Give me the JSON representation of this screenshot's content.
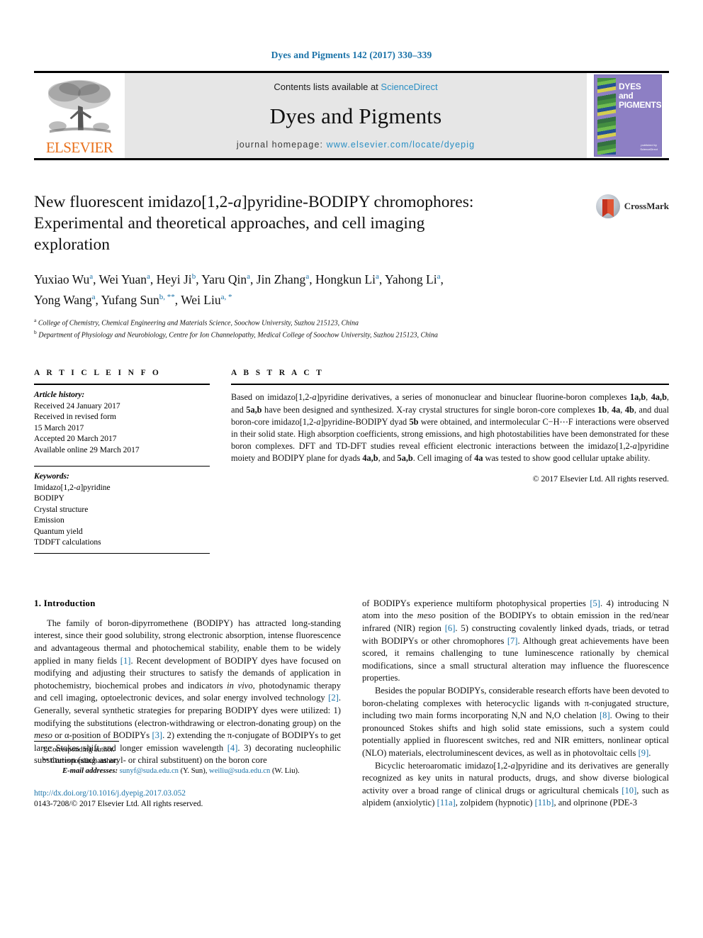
{
  "running_head": "Dyes and Pigments 142 (2017) 330–339",
  "masthead": {
    "publisher_logo_text": "ELSEVIER",
    "contents_prefix": "Contents lists available at ",
    "contents_link": "ScienceDirect",
    "journal_title": "Dyes and Pigments",
    "homepage_prefix": "journal homepage: ",
    "homepage_url": "www.elsevier.com/locate/dyepig",
    "cover": {
      "line1": "DYES",
      "line2": "and",
      "line3": "PIGMENTS",
      "publisher_note": "published by",
      "publisher_name": "ScienceDirect"
    }
  },
  "title": {
    "line1_a": "New fluorescent imidazo[1,2-",
    "line1_italic": "a",
    "line1_b": "]pyridine-BODIPY chromophores:",
    "line2": "Experimental and theoretical approaches, and cell imaging",
    "line3": "exploration"
  },
  "crossmark_label": "CrossMark",
  "authors": {
    "line1": "Yuxiao Wu a, Wei Yuan a, Heyi Ji b, Yaru Qin a, Jin Zhang a, Hongkun Li a, Yahong Li a,",
    "line2": "Yong Wang a, Yufang Sun b, **, Wei Liu a, *",
    "list": [
      {
        "name": "Yuxiao Wu",
        "mark": "a"
      },
      {
        "name": "Wei Yuan",
        "mark": "a"
      },
      {
        "name": "Heyi Ji",
        "mark": "b"
      },
      {
        "name": "Yaru Qin",
        "mark": "a"
      },
      {
        "name": "Jin Zhang",
        "mark": "a"
      },
      {
        "name": "Hongkun Li",
        "mark": "a"
      },
      {
        "name": "Yahong Li",
        "mark": "a"
      },
      {
        "name": "Yong Wang",
        "mark": "a"
      },
      {
        "name": "Yufang Sun",
        "mark": "b, **"
      },
      {
        "name": "Wei Liu",
        "mark": "a, *"
      }
    ]
  },
  "affiliations": [
    {
      "mark": "a",
      "text": "College of Chemistry, Chemical Engineering and Materials Science, Soochow University, Suzhou 215123, China"
    },
    {
      "mark": "b",
      "text": "Department of Physiology and Neurobiology, Centre for Ion Channelopathy, Medical College of Soochow University, Suzhou 215123, China"
    }
  ],
  "article_info": {
    "heading": "A R T I C L E   I N F O",
    "history_label": "Article history:",
    "history": [
      "Received 24 January 2017",
      "Received in revised form",
      "15 March 2017",
      "Accepted 20 March 2017",
      "Available online 29 March 2017"
    ],
    "keywords_label": "Keywords:",
    "keywords": [
      "Imidazo[1,2-a]pyridine",
      "BODIPY",
      "Crystal structure",
      "Emission",
      "Quantum yield",
      "TDDFT calculations"
    ]
  },
  "abstract": {
    "heading": "A B S T R A C T",
    "text": "Based on imidazo[1,2-a]pyridine derivatives, a series of mononuclear and binuclear fluorine-boron complexes 1a,b, 4a,b, and 5a,b have been designed and synthesized. X-ray crystal structures for single boron-core complexes 1b, 4a, 4b, and dual boron-core imidazo[1,2-a]pyridine-BODIPY dyad 5b were obtained, and intermolecular C−H⋯F interactions were observed in their solid state. High absorption coefficients, strong emissions, and high photostabilities have been demonstrated for these boron complexes. DFT and TD-DFT studies reveal efficient electronic interactions between the imidazo[1,2-a]pyridine moiety and BODIPY plane for dyads 4a,b, and 5a,b. Cell imaging of 4a was tested to show good cellular uptake ability.",
    "copyright": "© 2017 Elsevier Ltd. All rights reserved."
  },
  "section": {
    "number_title": "1. Introduction",
    "left_paragraph_1": "The family of boron-dipyrromethene (BODIPY) has attracted long-standing interest, since their good solubility, strong electronic absorption, intense fluorescence and advantageous thermal and photochemical stability, enable them to be widely applied in many fields [1]. Recent development of BODIPY dyes have focused on modifying and adjusting their structures to satisfy the demands of application in photochemistry, biochemical probes and indicators in vivo, photodynamic therapy and cell imaging, optoelectronic devices, and solar energy involved technology [2]. Generally, several synthetic strategies for preparing BODIPY dyes were utilized: 1) modifying the substitutions (electron-withdrawing or electron-donating group) on the meso or α-position of BODIPYs [3]. 2) extending the π-conjugate of BODIPYs to get large Stokes shift and longer emission wavelength [4]. 3) decorating nucleophilic substitution (such as aryl- or chiral substituent) on the boron core",
    "right_paragraph_1": "of BODIPYs experience multiform photophysical properties [5]. 4) introducing N atom into the meso position of the BODIPYs to obtain emission in the red/near infrared (NIR) region [6]. 5) constructing covalently linked dyads, triads, or tetrad with BODIPYs or other chromophores [7]. Although great achievements have been scored, it remains challenging to tune luminescence rationally by chemical modifications, since a small structural alteration may influence the fluorescence properties.",
    "right_paragraph_2": "Besides the popular BODIPYs, considerable research efforts have been devoted to boron-chelating complexes with heterocyclic ligands with π-conjugated structure, including two main forms incorporating N,N and N,O chelation [8]. Owing to their pronounced Stokes shifts and high solid state emissions, such a system could potentially applied in fluorescent switches, red and NIR emitters, nonlinear optical (NLO) materials, electroluminescent devices, as well as in photovoltaic cells [9].",
    "right_paragraph_3": "Bicyclic heteroaromatic imidazo[1,2-a]pyridine and its derivatives are generally recognized as key units in natural products, drugs, and show diverse biological activity over a broad range of clinical drugs or agricultural chemicals [10], such as alpidem (anxiolytic) [11a], zolpidem (hypnotic) [11b], and olprinone (PDE-3"
  },
  "footnotes": {
    "corr1_mark": "*",
    "corr1": "Corresponding author.",
    "corr2_mark": "**",
    "corr2": "Corresponding author.",
    "email_label": "E-mail addresses:",
    "email1": "sunyf@suda.edu.cn",
    "email1_owner": "(Y. Sun),",
    "email2": "weiliu@suda.edu.cn",
    "email2_owner": "(W. Liu).",
    "doi": "http://dx.doi.org/10.1016/j.dyepig.2017.03.052",
    "issn_line": "0143-7208/© 2017 Elsevier Ltd. All rights reserved."
  },
  "colors": {
    "link": "#1a72a8",
    "elsevier_orange": "#E9711C",
    "masthead_grey": "#e6e6e6",
    "cover_purple": "#8d7fc4"
  }
}
